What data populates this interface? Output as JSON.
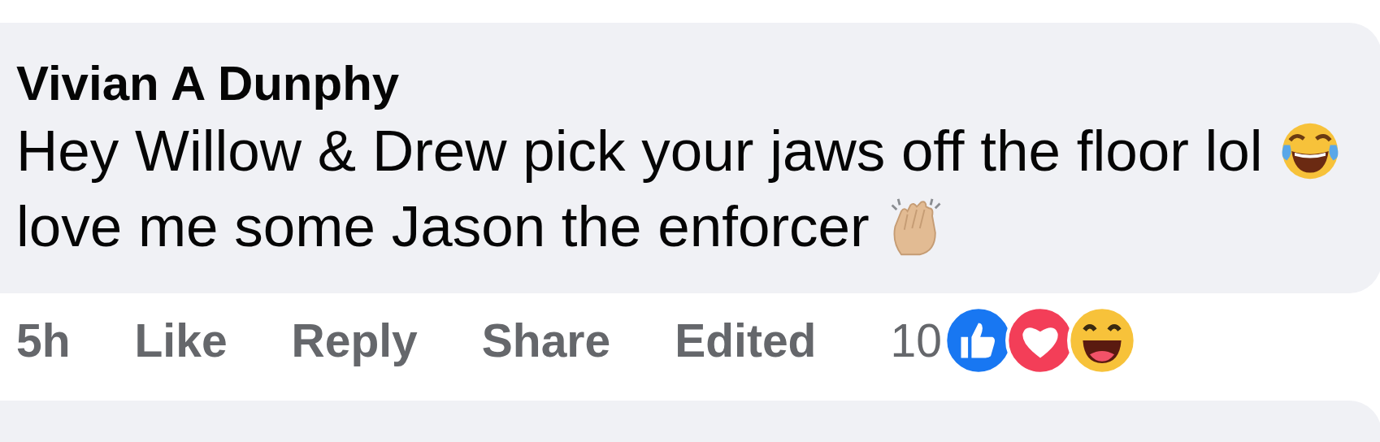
{
  "comment": {
    "author": "Vivian A Dunphy",
    "lines": [
      "Hey Willow & Drew pick your jaws off the floor lol",
      "love me some Jason the enforcer"
    ],
    "time": "5h",
    "actions": [
      "Like",
      "Reply",
      "Share"
    ],
    "edited_label": "Edited",
    "reaction_count": "10"
  }
}
